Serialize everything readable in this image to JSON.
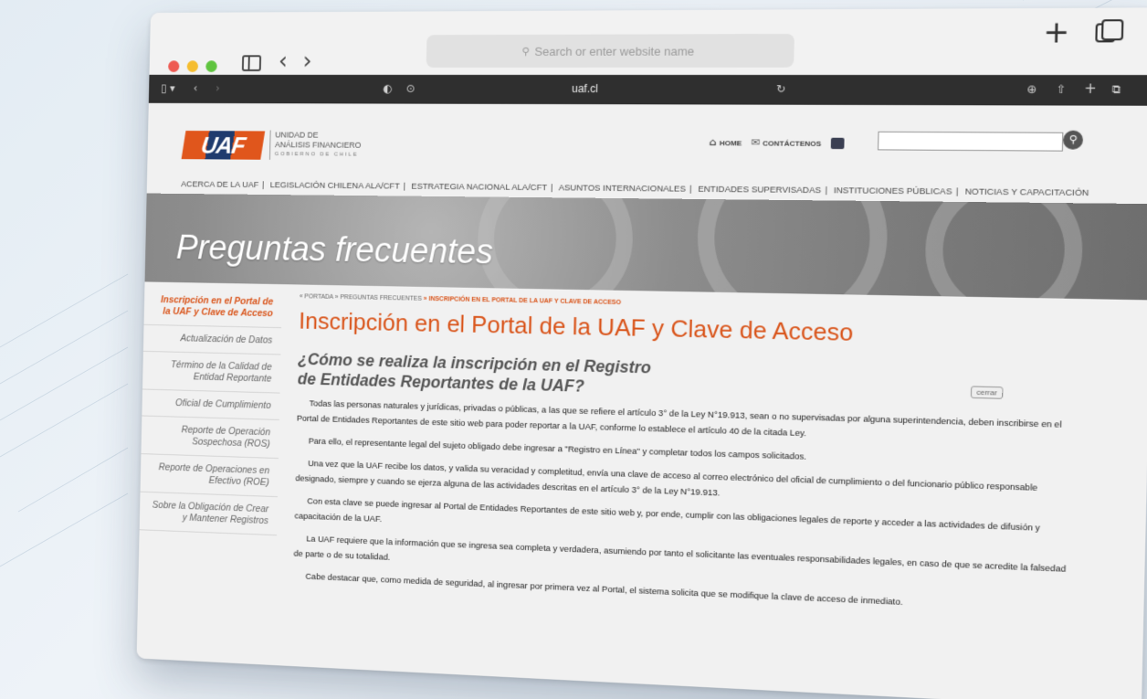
{
  "browser": {
    "search_placeholder": "Search or enter website name",
    "url": "uaf.cl"
  },
  "site": {
    "logo_mark": "UAF",
    "logo_line1": "UNIDAD DE",
    "logo_line2": "ANÁLISIS FINANCIERO",
    "logo_line3": "GOBIERNO DE CHILE",
    "home": "HOME",
    "contact": "CONTÁCTENOS",
    "nav": [
      "ACERCA DE LA UAF",
      "LEGISLACIÓN CHILENA ALA/CFT",
      "ESTRATEGIA NACIONAL ALA/CFT",
      "ASUNTOS INTERNACIONALES",
      "ENTIDADES SUPERVISADAS",
      "INSTITUCIONES PÚBLICAS",
      "NOTICIAS Y CAPACITACIÓN"
    ],
    "hero_title": "Preguntas frecuentes"
  },
  "sidebar": {
    "items": [
      {
        "label": "Inscripción en el Portal de la UAF y Clave de Acceso"
      },
      {
        "label": "Actualización de Datos"
      },
      {
        "label": "Término de la Calidad de Entidad Reportante"
      },
      {
        "label": "Oficial de Cumplimiento"
      },
      {
        "label": "Reporte de Operación Sospechosa (ROS)"
      },
      {
        "label": "Reporte de Operaciones en Efectivo (ROE)"
      },
      {
        "label": "Sobre la Obligación de Crear y Mantener Registros"
      }
    ]
  },
  "main": {
    "breadcrumb_home": "« PORTADA",
    "breadcrumb_faq": "» PREGUNTAS FRECUENTES",
    "breadcrumb_current": "» INSCRIPCIÓN EN EL PORTAL DE LA UAF Y CLAVE DE ACCESO",
    "title": "Inscripción en el Portal de la UAF y Clave de Acceso",
    "close_label": "cerrar",
    "question": "¿Cómo se realiza la inscripción en el Registro de Entidades Reportantes de la UAF?",
    "paragraphs": [
      "Todas las personas naturales y jurídicas, privadas o públicas, a las que se refiere el artículo 3° de la Ley N°19.913, sean o no supervisadas por alguna superintendencia, deben inscribirse en el Portal de Entidades Reportantes de este sitio web para poder reportar a la UAF, conforme lo establece el artículo 40 de la citada Ley.",
      "Para ello, el representante legal del sujeto obligado debe ingresar a \"Registro en Línea\" y completar todos los campos solicitados.",
      "Una vez que la UAF recibe los datos, y valida su veracidad y completitud, envía una clave de acceso al correo electrónico del oficial de cumplimiento o del funcionario público responsable designado, siempre y cuando se ejerza alguna de las actividades descritas en el artículo 3° de la Ley N°19.913.",
      "Con esta clave se puede ingresar al Portal de Entidades Reportantes de este sitio web y, por ende, cumplir con las obligaciones legales de reporte y acceder a las actividades de difusión y capacitación de la UAF.",
      "La UAF requiere que la información que se ingresa sea completa y verdadera, asumiendo por tanto el solicitante las eventuales responsabilidades legales, en caso de que se acredite la falsedad de parte o de su totalidad.",
      "Cabe destacar que, como medida de seguridad, al ingresar por primera vez al Portal, el sistema solicita que se modifique la clave de acceso de inmediato."
    ]
  }
}
